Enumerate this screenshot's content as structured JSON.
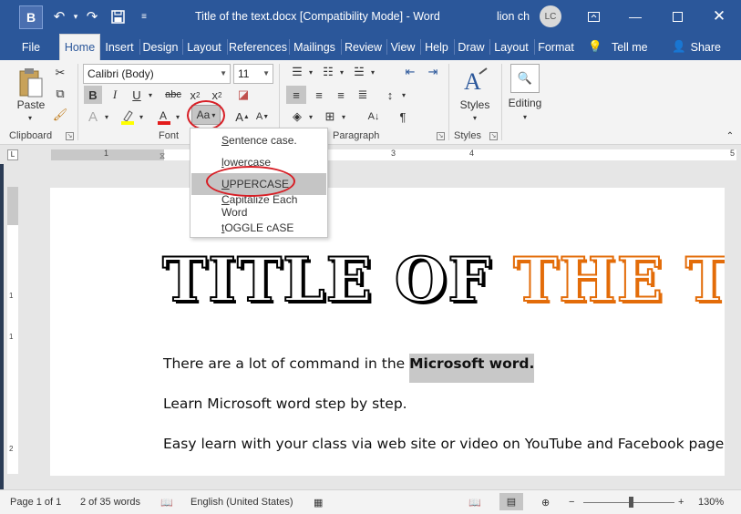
{
  "window": {
    "app_letter": "B",
    "title": "Title of the text.docx [Compatibility Mode]  -  Word",
    "user": "lion ch",
    "avatar_initials": "LC"
  },
  "tabs": [
    "File",
    "Home",
    "Insert",
    "Design",
    "Layout",
    "References",
    "Mailings",
    "Review",
    "View",
    "Help",
    "Draw",
    "Layout",
    "Format",
    "Tell me",
    "Share"
  ],
  "ribbon": {
    "clipboard": {
      "paste_label": "Paste",
      "group_label": "Clipboard"
    },
    "font": {
      "font_name": "Calibri (Body)",
      "font_size": "11",
      "group_label": "Font",
      "change_case_label": "Aa"
    },
    "paragraph": {
      "group_label": "Paragraph"
    },
    "styles": {
      "label": "Styles",
      "group_label": "Styles"
    },
    "editing": {
      "label": "Editing"
    }
  },
  "change_case_menu": [
    "Sentence case.",
    "lowercase",
    "UPPERCASE",
    "Capitalize Each Word",
    "tOGGLE cASE"
  ],
  "change_case_selected": "UPPERCASE",
  "ruler": {
    "numbers": [
      "1",
      "1",
      "2",
      "3",
      "4",
      "5"
    ],
    "vnumbers": [
      "1",
      "1",
      "2"
    ]
  },
  "document": {
    "title_black": "TITLE OF ",
    "title_orange": "THE TEXT",
    "para1_text": "There are a lot of command in the ",
    "para1_bold": "Microsoft word.",
    "para2": "Learn Microsoft word step by step.",
    "para3": "Easy learn with your class via web site or video on YouTube and Facebook page"
  },
  "statusbar": {
    "page": "Page 1 of 1",
    "words": "2 of 35 words",
    "language": "English (United States)",
    "zoom": "130%"
  },
  "colors": {
    "accent": "#2b579a",
    "title_orange": "#e36c09",
    "annotation_red": "#d71f26"
  }
}
